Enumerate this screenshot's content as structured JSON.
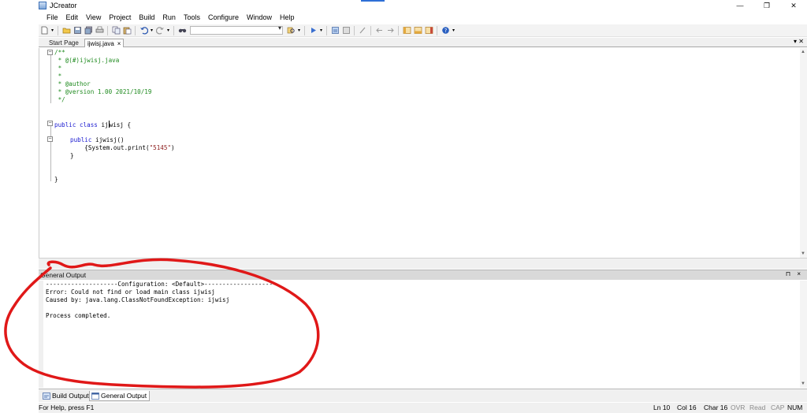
{
  "window": {
    "title": "JCreator",
    "minimize_icon": "minimize-icon",
    "maximize_icon": "restore-icon",
    "close_icon": "close-icon"
  },
  "menu": {
    "items": [
      "File",
      "Edit",
      "View",
      "Project",
      "Build",
      "Run",
      "Tools",
      "Configure",
      "Window",
      "Help"
    ]
  },
  "toolbar": {
    "icons": [
      "new-file-icon",
      "open-folder-icon",
      "save-icon",
      "save-all-icon",
      "print-icon",
      "copy-icon",
      "paste-icon",
      "undo-icon",
      "redo-icon",
      "find-icon",
      "combo-dropdown",
      "find-in-files-icon",
      "run-icon",
      "build-icon",
      "build-project-icon",
      "compile-icon",
      "back-icon",
      "forward-icon",
      "workspace-icon",
      "toggle-output-icon",
      "bookmark-icon",
      "help-icon"
    ]
  },
  "tabs": {
    "start_page": "Start Page",
    "active_file": "ijwisj.java",
    "active_close": "×"
  },
  "editor": {
    "lines": [
      {
        "text": "/**",
        "class": "c-comment"
      },
      {
        "text": " * @(#)ijwisj.java",
        "class": "c-comment"
      },
      {
        "text": " *",
        "class": "c-comment"
      },
      {
        "text": " *",
        "class": "c-comment"
      },
      {
        "text": " * @author",
        "class": "c-comment"
      },
      {
        "text": " * @version 1.00 2021/10/19",
        "class": "c-comment"
      },
      {
        "text": " */",
        "class": "c-comment"
      }
    ],
    "class_decl": {
      "kw": "public class",
      "name_before_caret": " ij",
      "name_after_caret": "wisj {"
    },
    "method_decl": {
      "kw": "public",
      "rest": " ijwisj()"
    },
    "method_body_prefix": "    {System.out.print(",
    "method_body_string": "\"5145\"",
    "method_body_suffix": ")",
    "method_close": "}",
    "class_close": "}"
  },
  "output": {
    "header_label": "General Output",
    "pin_label": "⊓ ×",
    "lines": [
      "--------------------Configuration: <Default>--------------------",
      "Error: Could not find or load main class ijwisj",
      "Caused by: java.lang.ClassNotFoundException: ijwisj",
      "",
      "Process completed."
    ]
  },
  "bottom_tabs": {
    "build_output": "Build Output",
    "general_output": "General Output"
  },
  "status": {
    "help": "For Help, press F1",
    "ln": "Ln 10",
    "col": "Col 16",
    "char": "Char 16",
    "ovr": "OVR",
    "read": "Read",
    "cap": "CAP",
    "num": "NUM"
  },
  "colors": {
    "comment": "#1e8a1e",
    "keyword": "#1a1ad0",
    "string": "#8b1a1a",
    "annotation": "#e01818"
  }
}
